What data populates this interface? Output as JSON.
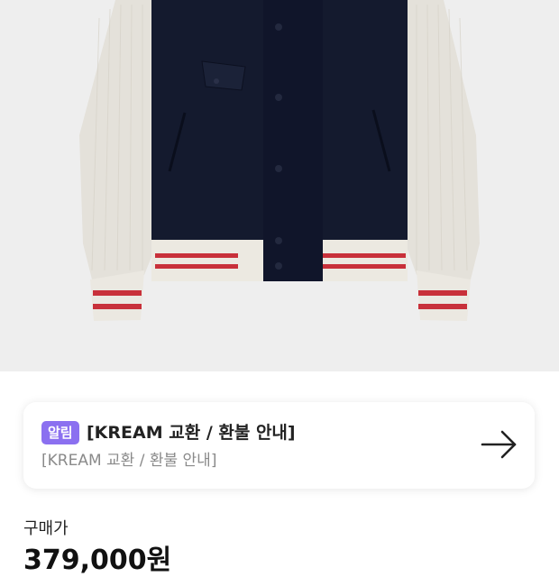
{
  "product": {
    "image_alt": "varsity-jacket-navy-cream"
  },
  "notice": {
    "badge": "알림",
    "title": "[KREAM 교환 / 환불 안내]",
    "subtitle": "[KREAM 교환 / 환불 안내]",
    "badge_color": "#8B70F0",
    "arrow_icon": "arrow-right-icon"
  },
  "price": {
    "label": "구매가",
    "value": "379,000원"
  }
}
